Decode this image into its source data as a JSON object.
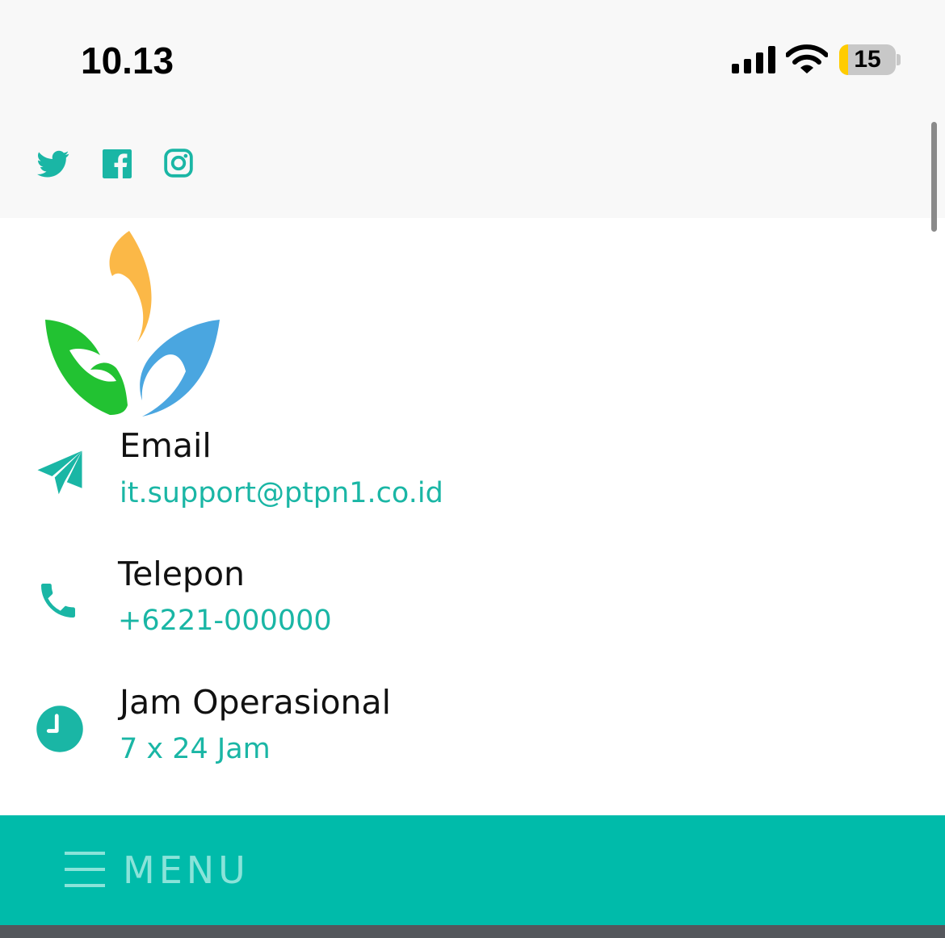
{
  "status_bar": {
    "time": "10.13",
    "battery_level": "15",
    "battery_fraction": 0.15,
    "signal_icon": "cellular-signal-icon",
    "wifi_icon": "wifi-icon"
  },
  "social_links": [
    {
      "icon": "twitter-icon"
    },
    {
      "icon": "facebook-icon"
    },
    {
      "icon": "instagram-icon"
    }
  ],
  "logo": {
    "icon": "ptpn-leaves-logo"
  },
  "contacts": [
    {
      "label": "Email",
      "value": "it.support@ptpn1.co.id",
      "icon": "paper-plane-icon"
    },
    {
      "label": "Telepon",
      "value": "+6221-000000",
      "icon": "phone-icon"
    },
    {
      "label": "Jam Operasional",
      "value": "7 x 24 Jam",
      "icon": "clock-icon"
    }
  ],
  "menu": {
    "label": "MENU",
    "icon": "hamburger-icon"
  },
  "colors": {
    "accent": "#1ab6a5",
    "menu_bar": "#00bbaa",
    "logo_orange": "#fbb847",
    "logo_green": "#22c232",
    "logo_blue": "#4aa6e0",
    "battery_low": "#ffcc00"
  }
}
